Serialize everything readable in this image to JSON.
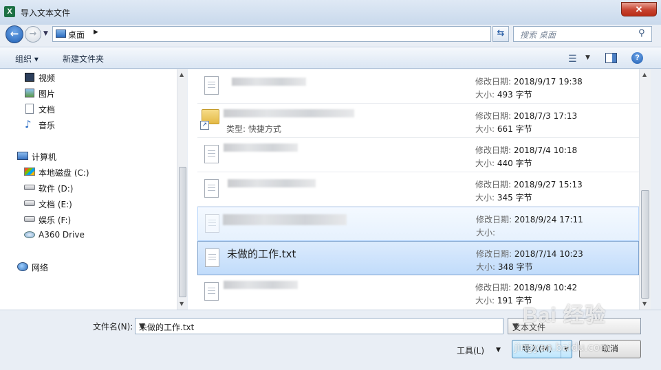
{
  "window": {
    "title": "导入文本文件",
    "app_icon": "X",
    "close_glyph": "✕"
  },
  "address": {
    "location": "桌面",
    "search_placeholder": "搜索 桌面"
  },
  "toolbar": {
    "organize": "组织 ▾",
    "new_folder": "新建文件夹",
    "help_glyph": "?"
  },
  "nav": {
    "items": [
      {
        "label": "视频",
        "icon": "video-icon"
      },
      {
        "label": "图片",
        "icon": "picture-icon"
      },
      {
        "label": "文档",
        "icon": "document-icon"
      },
      {
        "label": "音乐",
        "icon": "music-icon"
      },
      {
        "label": "计算机",
        "icon": "computer-icon"
      },
      {
        "label": "本地磁盘 (C:)",
        "icon": "drive-icon"
      },
      {
        "label": "软件 (D:)",
        "icon": "drive-icon"
      },
      {
        "label": "文档 (E:)",
        "icon": "drive-icon"
      },
      {
        "label": "娱乐 (F:)",
        "icon": "drive-icon"
      },
      {
        "label": "A360 Drive",
        "icon": "cloud-drive-icon"
      },
      {
        "label": "网络",
        "icon": "network-icon"
      }
    ]
  },
  "files": {
    "date_label": "修改日期:",
    "size_label": "大小:",
    "rows": [
      {
        "name": "",
        "type": "",
        "date": "2018/9/17 19:38",
        "size": "493 字节"
      },
      {
        "name": "",
        "type": "类型: 快捷方式",
        "date": "2018/7/3 17:13",
        "size": "661 字节"
      },
      {
        "name": "",
        "type": "",
        "date": "2018/7/4 10:18",
        "size": "440 字节"
      },
      {
        "name": "",
        "type": "",
        "date": "2018/9/27 15:13",
        "size": "345 字节"
      },
      {
        "name": "",
        "type": "",
        "date": "2018/9/24 17:11",
        "size": ""
      },
      {
        "name": "未做的工作.txt",
        "type": "",
        "date": "2018/7/14 10:23",
        "size": "348 字节"
      },
      {
        "name": "",
        "type": "",
        "date": "2018/9/8 10:42",
        "size": "191 字节"
      }
    ]
  },
  "bottom": {
    "filename_label": "文件名(N):",
    "filename_value": "未做的工作.txt",
    "filetype_value": "文本文件",
    "tools": "工具(L)",
    "open": "导入(M)",
    "cancel": "取消"
  },
  "watermark": {
    "text": "Bai 经验",
    "sub": "jingyan.baidu.com"
  }
}
